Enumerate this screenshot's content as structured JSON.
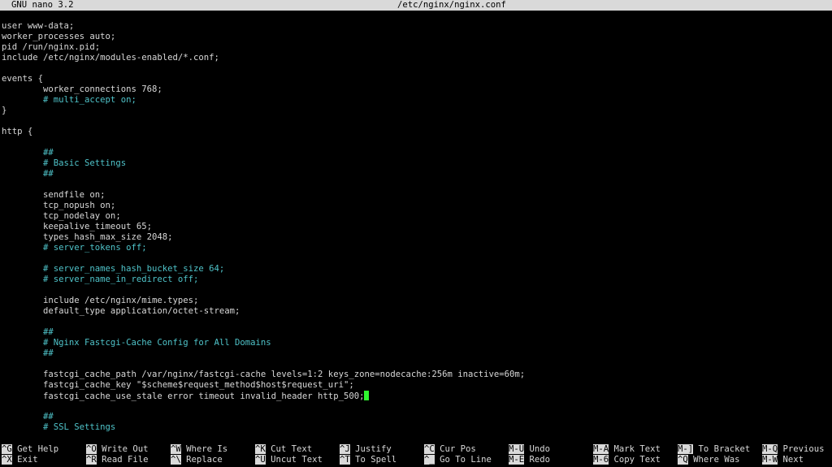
{
  "titlebar": {
    "app": "GNU nano 3.2",
    "file": "/etc/nginx/nginx.conf"
  },
  "editor": {
    "lines": [
      {
        "text": "user www-data;",
        "comment": false
      },
      {
        "text": "worker_processes auto;",
        "comment": false
      },
      {
        "text": "pid /run/nginx.pid;",
        "comment": false
      },
      {
        "text": "include /etc/nginx/modules-enabled/*.conf;",
        "comment": false
      },
      {
        "text": "",
        "comment": false
      },
      {
        "text": "events {",
        "comment": false
      },
      {
        "text": "        worker_connections 768;",
        "comment": false
      },
      {
        "text": "        # multi_accept on;",
        "comment": true
      },
      {
        "text": "}",
        "comment": false
      },
      {
        "text": "",
        "comment": false
      },
      {
        "text": "http {",
        "comment": false
      },
      {
        "text": "",
        "comment": false
      },
      {
        "text": "        ##",
        "comment": true
      },
      {
        "text": "        # Basic Settings",
        "comment": true
      },
      {
        "text": "        ##",
        "comment": true
      },
      {
        "text": "",
        "comment": false
      },
      {
        "text": "        sendfile on;",
        "comment": false
      },
      {
        "text": "        tcp_nopush on;",
        "comment": false
      },
      {
        "text": "        tcp_nodelay on;",
        "comment": false
      },
      {
        "text": "        keepalive_timeout 65;",
        "comment": false
      },
      {
        "text": "        types_hash_max_size 2048;",
        "comment": false
      },
      {
        "text": "        # server_tokens off;",
        "comment": true
      },
      {
        "text": "",
        "comment": false
      },
      {
        "text": "        # server_names_hash_bucket_size 64;",
        "comment": true
      },
      {
        "text": "        # server_name_in_redirect off;",
        "comment": true
      },
      {
        "text": "",
        "comment": false
      },
      {
        "text": "        include /etc/nginx/mime.types;",
        "comment": false
      },
      {
        "text": "        default_type application/octet-stream;",
        "comment": false
      },
      {
        "text": "",
        "comment": false
      },
      {
        "text": "        ##",
        "comment": true
      },
      {
        "text": "        # Nginx Fastcgi-Cache Config for All Domains",
        "comment": true
      },
      {
        "text": "        ##",
        "comment": true
      },
      {
        "text": "",
        "comment": false
      },
      {
        "text": "        fastcgi_cache_path /var/nginx/fastcgi-cache levels=1:2 keys_zone=nodecache:256m inactive=60m;",
        "comment": false
      },
      {
        "text": "        fastcgi_cache_key \"$scheme$request_method$host$request_uri\";",
        "comment": false
      },
      {
        "text": "        fastcgi_cache_use_stale error timeout invalid_header http_500;",
        "comment": false,
        "cursor": true
      },
      {
        "text": "",
        "comment": false
      },
      {
        "text": "        ##",
        "comment": true
      },
      {
        "text": "        # SSL Settings",
        "comment": true
      }
    ]
  },
  "shortcuts": [
    {
      "key": "^G",
      "label": "Get Help",
      "icon": "help-icon"
    },
    {
      "key": "^X",
      "label": "Exit",
      "icon": "exit-icon"
    },
    {
      "key": "^O",
      "label": "Write Out",
      "icon": "save-icon"
    },
    {
      "key": "^R",
      "label": "Read File",
      "icon": "open-icon"
    },
    {
      "key": "^W",
      "label": "Where Is",
      "icon": "search-icon"
    },
    {
      "key": "^\\",
      "label": "Replace",
      "icon": "replace-icon"
    },
    {
      "key": "^K",
      "label": "Cut Text",
      "icon": "cut-icon"
    },
    {
      "key": "^U",
      "label": "Uncut Text",
      "icon": "paste-icon"
    },
    {
      "key": "^J",
      "label": "Justify",
      "icon": "justify-icon"
    },
    {
      "key": "^T",
      "label": "To Spell",
      "icon": "spell-icon"
    },
    {
      "key": "^C",
      "label": "Cur Pos",
      "icon": "position-icon"
    },
    {
      "key": "^_",
      "label": "Go To Line",
      "icon": "goto-icon"
    },
    {
      "key": "M-U",
      "label": "Undo",
      "icon": "undo-icon"
    },
    {
      "key": "M-E",
      "label": "Redo",
      "icon": "redo-icon"
    },
    {
      "key": "M-A",
      "label": "Mark Text",
      "icon": "mark-icon"
    },
    {
      "key": "M-6",
      "label": "Copy Text",
      "icon": "copy-icon"
    },
    {
      "key": "M-]",
      "label": "To Bracket",
      "icon": "bracket-icon"
    },
    {
      "key": "^Q",
      "label": "Where Was",
      "icon": "search-back-icon"
    },
    {
      "key": "M-Q",
      "label": "Previous",
      "icon": "previous-icon"
    },
    {
      "key": "M-W",
      "label": "Next",
      "icon": "next-icon"
    }
  ]
}
